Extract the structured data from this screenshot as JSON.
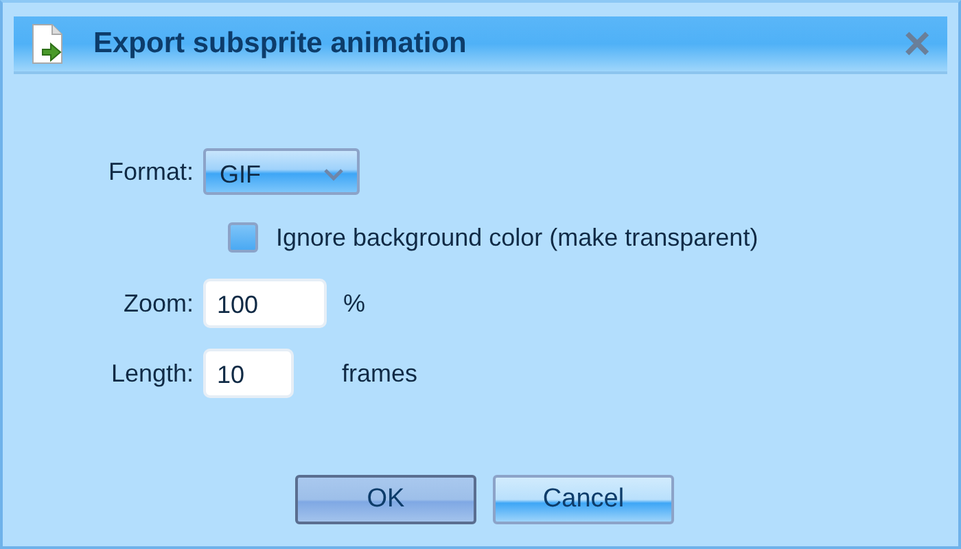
{
  "window": {
    "title": "Export subsprite animation",
    "close": "×"
  },
  "format": {
    "label": "Format:",
    "value": "GIF"
  },
  "ignore_background": {
    "label": "Ignore background color (make transparent)",
    "checked": false
  },
  "zoom": {
    "label": "Zoom:",
    "value": "100",
    "unit": "%"
  },
  "length": {
    "label": "Length:",
    "value": "10",
    "unit": "frames"
  },
  "buttons": [
    {
      "label": "OK",
      "focused": true
    },
    {
      "label": "Cancel",
      "focused": false
    }
  ]
}
